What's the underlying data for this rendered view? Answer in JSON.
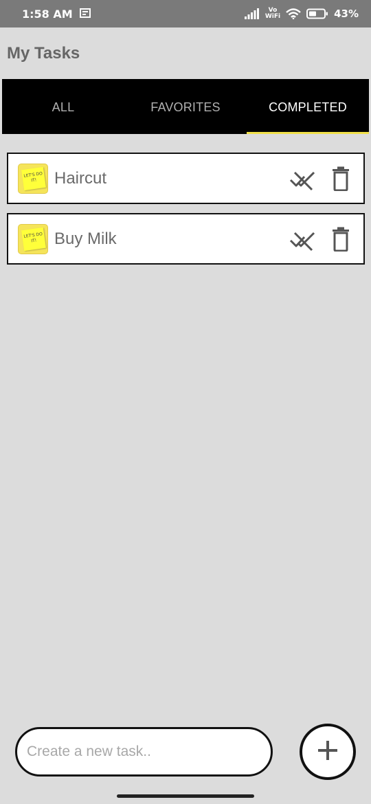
{
  "status_bar": {
    "time": "1:58 AM",
    "vo": "Vo",
    "wifi_label": "WiFi",
    "battery": "43%",
    "icons": [
      "screenshot-icon",
      "signal-icon",
      "wifi-icon",
      "battery-icon"
    ]
  },
  "app": {
    "title": "My Tasks"
  },
  "tabs": [
    {
      "label": "ALL",
      "active": false
    },
    {
      "label": "FAVORITES",
      "active": false
    },
    {
      "label": "COMPLETED",
      "active": true
    }
  ],
  "tasks": [
    {
      "title": "Haircut",
      "thumb_text": "LET'S DO IT!",
      "icons": [
        "remove-done-icon",
        "delete-icon"
      ]
    },
    {
      "title": "Buy Milk",
      "thumb_text": "LET'S DO IT!",
      "icons": [
        "remove-done-icon",
        "delete-icon"
      ]
    }
  ],
  "composer": {
    "placeholder": "Create a new task..",
    "value": "",
    "add_icon": "plus-icon"
  },
  "colors": {
    "status_bar": "#7a7a7a",
    "background": "#dcdcdc",
    "tab_bar": "#000000",
    "tab_indicator": "#f0e04a",
    "active_tab_text": "#ffffff",
    "inactive_tab_text": "#b0b0b0"
  }
}
